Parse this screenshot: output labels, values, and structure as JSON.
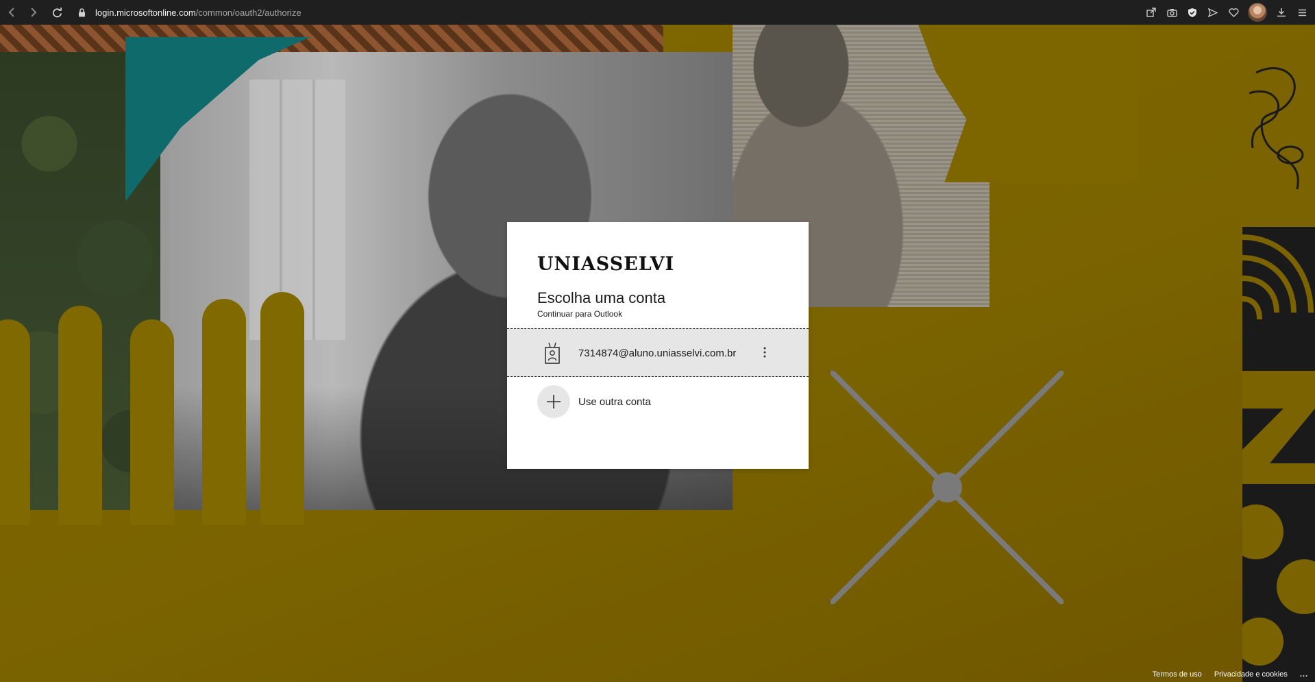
{
  "browser": {
    "url_host": "login.microsoftonline.com",
    "url_path": "/common/oauth2/authorize"
  },
  "icons": {
    "back": "back-arrow-icon",
    "forward": "forward-arrow-icon",
    "reload": "reload-icon",
    "lock": "lock-icon",
    "share": "share-icon",
    "screenshot": "camera-icon",
    "shield": "shield-icon",
    "send": "send-icon",
    "heart": "heart-icon",
    "download": "download-icon",
    "menu": "menu-icon",
    "account": "id-badge-icon",
    "more": "more-vertical-icon",
    "add": "plus-icon"
  },
  "card": {
    "brand": "UNIASSELVI",
    "title": "Escolha uma conta",
    "subtitle": "Continuar para Outlook",
    "account_email": "7314874@aluno.uniasselvi.com.br",
    "other_account": "Use outra conta"
  },
  "footer": {
    "terms": "Termos de uso",
    "privacy": "Privacidade e cookies",
    "more": "..."
  },
  "colors": {
    "chrome_bg": "#1f1f1f",
    "background": "#7a6400",
    "card_bg": "#ffffff",
    "row_highlight": "#e6e6e6",
    "teal": "#0f6b6b"
  }
}
